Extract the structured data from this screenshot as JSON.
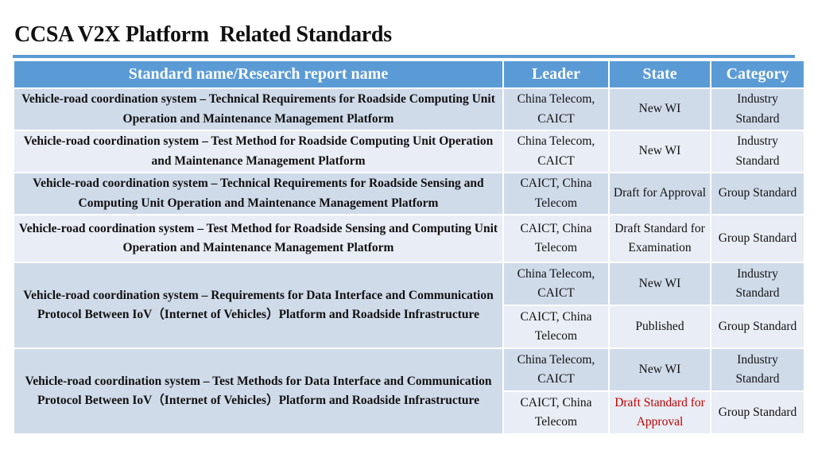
{
  "title": "CCSA V2X Platform  Related Standards",
  "table": {
    "headers": [
      "Standard name/Research report name",
      "Leader",
      "State",
      "Category"
    ],
    "rows": [
      {
        "name": "Vehicle-road coordination system – Technical Requirements for Roadside Computing Unit Operation and Maintenance Management Platform",
        "entries": [
          {
            "leader": "China Telecom, CAICT",
            "state": "New WI",
            "category": "Industry Standard"
          }
        ]
      },
      {
        "name": "Vehicle-road coordination system – Test Method for Roadside Computing Unit Operation and Maintenance Management Platform",
        "entries": [
          {
            "leader": "China Telecom, CAICT",
            "state": "New WI",
            "category": "Industry Standard"
          }
        ]
      },
      {
        "name": "Vehicle-road coordination system – Technical Requirements for Roadside Sensing and Computing Unit Operation and Maintenance Management Platform",
        "entries": [
          {
            "leader": "CAICT, China Telecom",
            "state": "Draft for Approval",
            "category": "Group Standard"
          }
        ]
      },
      {
        "name": "Vehicle-road coordination system – Test Method for Roadside Sensing and Computing Unit Operation and Maintenance Management Platform",
        "entries": [
          {
            "leader": "CAICT, China Telecom",
            "state": "Draft Standard for Examination",
            "category": "Group Standard"
          }
        ]
      },
      {
        "name": "Vehicle-road coordination system – Requirements for Data Interface and Communication Protocol Between IoV（Internet of Vehicles）Platform and Roadside Infrastructure",
        "entries": [
          {
            "leader": "China Telecom, CAICT",
            "state": "New WI",
            "category": "Industry Standard"
          },
          {
            "leader": "CAICT, China Telecom",
            "state": "Published",
            "category": "Group Standard"
          }
        ]
      },
      {
        "name": "Vehicle-road coordination system – Test Methods for Data Interface and Communication Protocol Between IoV（Internet of Vehicles）Platform and Roadside Infrastructure",
        "entries": [
          {
            "leader": "China Telecom, CAICT",
            "state": "New WI",
            "category": "Industry Standard"
          },
          {
            "leader": "CAICT, China Telecom",
            "state": "Draft Standard for Approval",
            "category": "Group Standard",
            "highlight": true
          }
        ]
      }
    ]
  },
  "colors": {
    "header_bg": "#5b9bd5",
    "row_dark": "#d0dbea",
    "row_light": "#e9edf5",
    "highlight_text": "#c00000"
  }
}
